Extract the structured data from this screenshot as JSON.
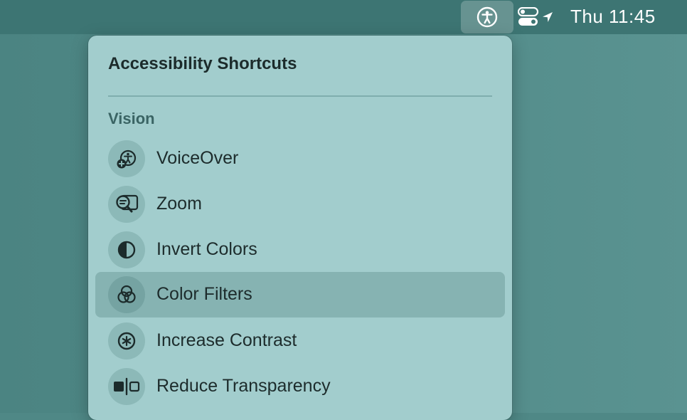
{
  "menubar": {
    "clock": "Thu 11:45",
    "icons": {
      "accessibility": "accessibility-icon",
      "control_center": "control-center-icon",
      "location": "location-arrow-icon"
    }
  },
  "panel": {
    "title": "Accessibility Shortcuts",
    "section": "Vision",
    "items": [
      {
        "label": "VoiceOver",
        "icon": "voiceover-icon",
        "selected": false
      },
      {
        "label": "Zoom",
        "icon": "zoom-icon",
        "selected": false
      },
      {
        "label": "Invert Colors",
        "icon": "invert-colors-icon",
        "selected": false
      },
      {
        "label": "Color Filters",
        "icon": "color-filters-icon",
        "selected": true
      },
      {
        "label": "Increase Contrast",
        "icon": "increase-contrast-icon",
        "selected": false
      },
      {
        "label": "Reduce Transparency",
        "icon": "reduce-transparency-icon",
        "selected": false
      }
    ]
  },
  "colors": {
    "desktop": "#4f8886",
    "menubar": "#3d7573",
    "panel": "#a2cdcd",
    "selection": "#86b3b2"
  }
}
